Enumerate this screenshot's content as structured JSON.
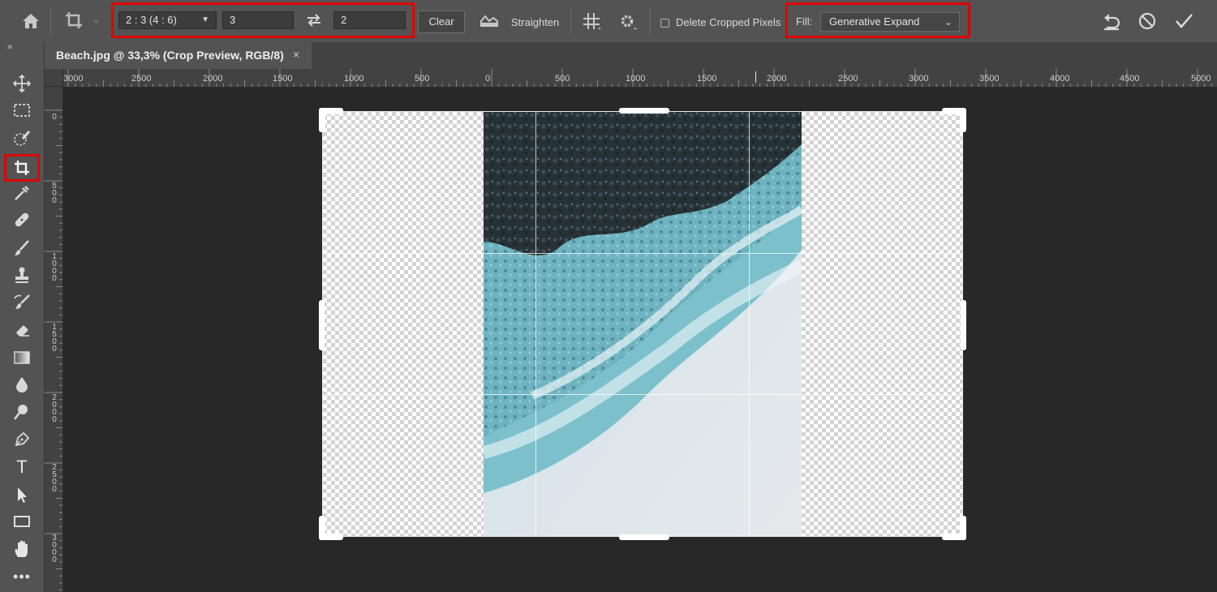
{
  "options_bar": {
    "home_icon": "home-icon",
    "tool_icon": "crop-icon",
    "ratio_preset": "2 : 3 (4 : 6)",
    "ratio_width": "3",
    "ratio_height": "2",
    "swap_icon": "swap-arrows-icon",
    "clear_label": "Clear",
    "straighten_label": "Straighten",
    "grid_overlay_icon": "grid-overlay-icon",
    "settings_icon": "gear-icon",
    "delete_cropped_label": "Delete Cropped Pixels",
    "delete_cropped_checked": false,
    "fill_label": "Fill:",
    "fill_value": "Generative Expand",
    "reset_icon": "reset-icon",
    "cancel_icon": "cancel-icon",
    "commit_icon": "checkmark-icon"
  },
  "highlight_color": "#e10000",
  "document_tab": {
    "title": "Beach.jpg @ 33,3% (Crop Preview, RGB/8)",
    "close_symbol": "×"
  },
  "ruler_horizontal": [
    "3000",
    "2500",
    "2000",
    "1500",
    "1000",
    "500",
    "0",
    "500",
    "1000",
    "1500",
    "2000",
    "2500",
    "3000",
    "3500",
    "4000",
    "4500",
    "5000"
  ],
  "ruler_vertical": [
    "0",
    "500",
    "1000",
    "1500",
    "2000",
    "2500",
    "3000"
  ],
  "toolbar": {
    "collapse_symbol": "»",
    "tools": [
      "move-tool",
      "marquee-tool",
      "object-selection-tool",
      "crop-tool",
      "eyedropper-tool",
      "healing-brush-tool",
      "brush-tool",
      "clone-stamp-tool",
      "history-brush-tool",
      "eraser-tool",
      "gradient-tool",
      "blur-tool",
      "dodge-tool",
      "pen-tool",
      "type-tool",
      "path-selection-tool",
      "rectangle-tool",
      "hand-tool",
      "more-tools"
    ],
    "type_tool_glyph": "T",
    "active_tool": "crop-tool"
  }
}
